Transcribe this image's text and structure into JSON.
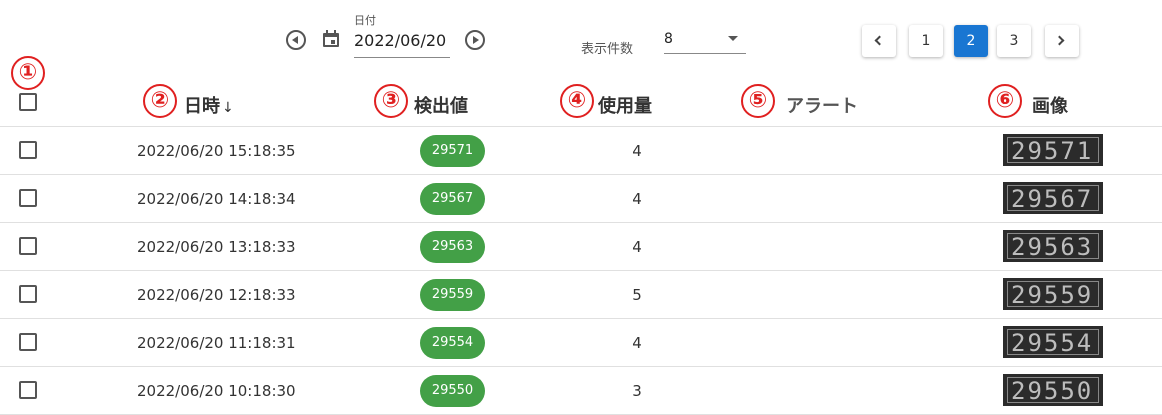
{
  "toolbar": {
    "date_caption": "日付",
    "date_value": "2022/06/20",
    "count_label": "表示件数",
    "count_value": "8",
    "pages": [
      "1",
      "2",
      "3"
    ],
    "active_page": "2",
    "active_color": "#1976d2"
  },
  "annotations": [
    "①",
    "②",
    "③",
    "④",
    "⑤",
    "⑥"
  ],
  "columns": {
    "datetime": "日時",
    "sort_indicator": "↓",
    "value": "検出値",
    "usage": "使用量",
    "alert": "アラート",
    "image": "画像"
  },
  "colors": {
    "pill": "#43a047",
    "annotation": "#e02020"
  },
  "rows": [
    {
      "datetime": "2022/06/20 15:18:35",
      "value": "29571",
      "usage": "4",
      "image_text": "29571"
    },
    {
      "datetime": "2022/06/20 14:18:34",
      "value": "29567",
      "usage": "4",
      "image_text": "29567"
    },
    {
      "datetime": "2022/06/20 13:18:33",
      "value": "29563",
      "usage": "4",
      "image_text": "29563"
    },
    {
      "datetime": "2022/06/20 12:18:33",
      "value": "29559",
      "usage": "5",
      "image_text": "29559"
    },
    {
      "datetime": "2022/06/20 11:18:31",
      "value": "29554",
      "usage": "4",
      "image_text": "29554"
    },
    {
      "datetime": "2022/06/20 10:18:30",
      "value": "29550",
      "usage": "3",
      "image_text": "29550"
    }
  ]
}
